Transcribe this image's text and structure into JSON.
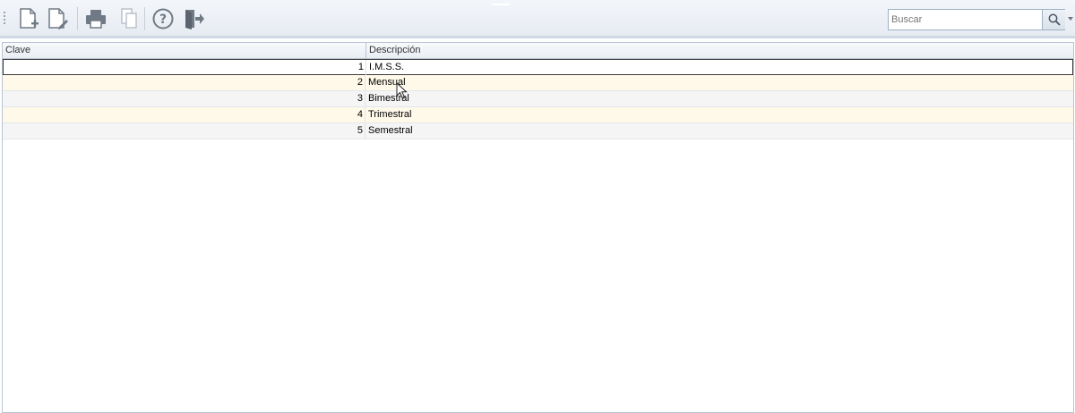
{
  "toolbar": {
    "buttons": [
      {
        "name": "new-document-icon"
      },
      {
        "name": "edit-document-icon"
      },
      {
        "name": "print-icon"
      },
      {
        "name": "copy-icon"
      },
      {
        "name": "help-icon"
      },
      {
        "name": "exit-icon"
      }
    ],
    "search": {
      "placeholder": "Buscar",
      "value": ""
    }
  },
  "grid": {
    "columns": [
      "Clave",
      "Descripción"
    ],
    "rows": [
      {
        "clave": "1",
        "descripcion": "I.M.S.S."
      },
      {
        "clave": "2",
        "descripcion": "Mensual"
      },
      {
        "clave": "3",
        "descripcion": "Bimestral"
      },
      {
        "clave": "4",
        "descripcion": "Trimestral"
      },
      {
        "clave": "5",
        "descripcion": "Semestral"
      }
    ],
    "selected_row": 1
  },
  "colors": {
    "row_odd": "#f5f5f5",
    "row_even": "#fff9ea",
    "icon_gray": "#6b7280"
  }
}
